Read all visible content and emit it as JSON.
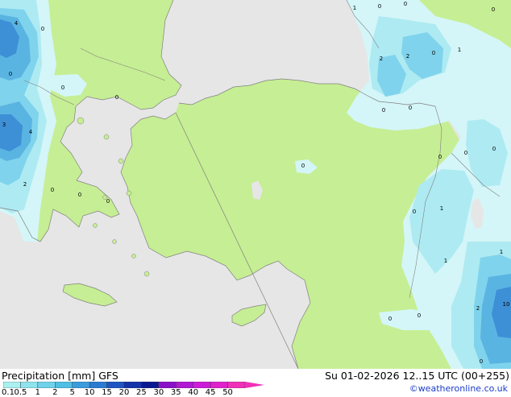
{
  "legend": {
    "title": "Precipitation [mm]",
    "model": "GFS",
    "ticks": [
      "0.1",
      "0.5",
      "1",
      "2",
      "5",
      "10",
      "15",
      "20",
      "25",
      "30",
      "35",
      "40",
      "45",
      "50"
    ],
    "colors": [
      "#aaf0f0",
      "#8ee3ee",
      "#6fd2ea",
      "#4fbfe4",
      "#3a9cdc",
      "#2a7ad2",
      "#1f55c2",
      "#1433aa",
      "#0a1890",
      "#8a10c8",
      "#b018d4",
      "#cc1cd8",
      "#e022cc",
      "#f030b8"
    ]
  },
  "valid_time": "Su 01-02-2026 12..15 UTC (00+255)",
  "credit": "©weatheronline.co.uk",
  "colors": {
    "land": "#c6ee94",
    "sea_and_outside": "#e6e6e6",
    "precip_light": "#d4f6f8",
    "precip_mid": "#aeeaf2",
    "precip_heavy": "#7fd3ec",
    "precip_heavier": "#5ab4e2",
    "precip_heaviest": "#3d8fd6",
    "coast": "#808080"
  },
  "map": {
    "precip_labels": [
      "4",
      "0",
      "0",
      "0",
      "0",
      "3",
      "4",
      "2",
      "0",
      "0",
      "0",
      "0",
      "1",
      "0",
      "0",
      "0",
      "2",
      "2",
      "0",
      "1",
      "0",
      "0",
      "0",
      "0",
      "0",
      "0",
      "1",
      "1",
      "1",
      "2",
      "10",
      "0",
      "0",
      "0"
    ]
  }
}
